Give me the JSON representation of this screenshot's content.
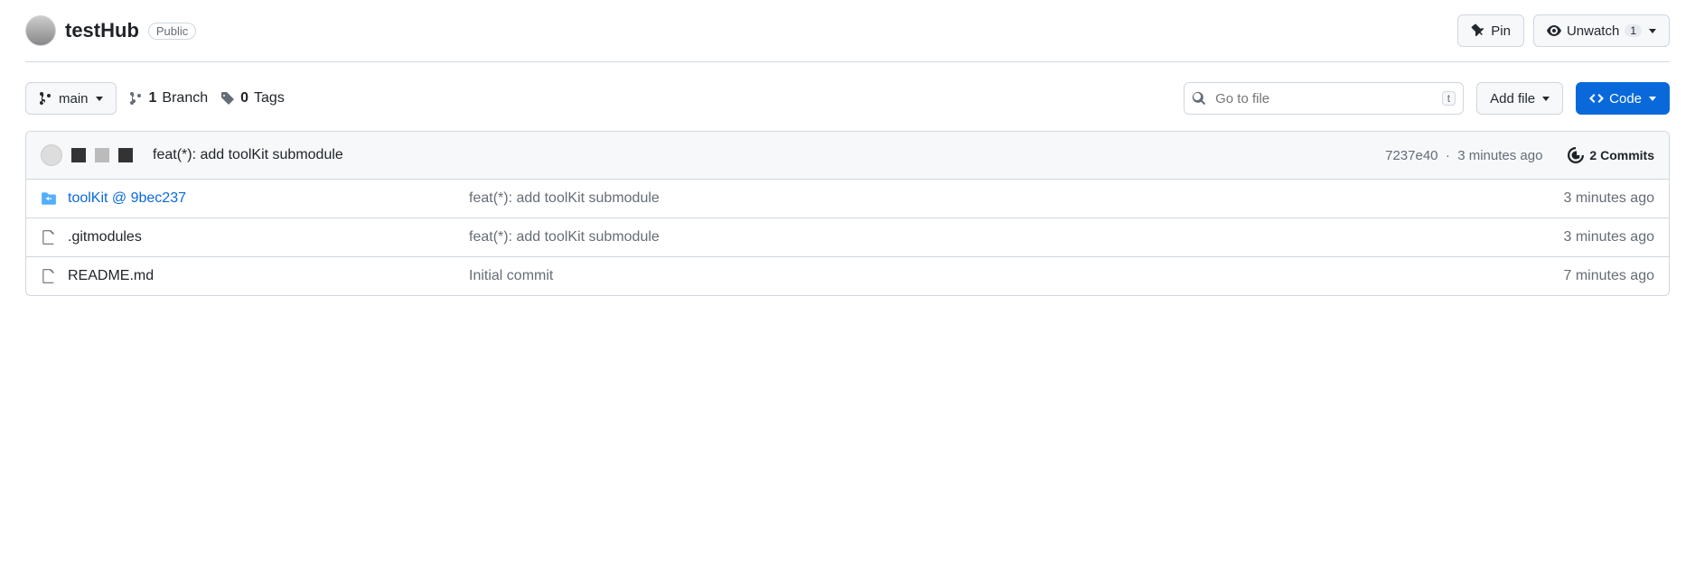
{
  "header": {
    "repo_name": "testHub",
    "visibility": "Public",
    "pin_label": "Pin",
    "unwatch_label": "Unwatch",
    "watch_count": "1"
  },
  "toolbar": {
    "branch_name": "main",
    "branches_count": "1",
    "branches_label": "Branch",
    "tags_count": "0",
    "tags_label": "Tags",
    "search_placeholder": "Go to file",
    "search_kbd": "t",
    "add_file_label": "Add file",
    "code_label": "Code"
  },
  "latest_commit": {
    "message": "feat(*): add toolKit submodule",
    "sha": "7237e40",
    "time": "3 minutes ago",
    "commits_count": "2 Commits"
  },
  "files": [
    {
      "type": "submodule",
      "name": "toolKit @ 9bec237",
      "message": "feat(*): add toolKit submodule",
      "time": "3 minutes ago"
    },
    {
      "type": "file",
      "name": ".gitmodules",
      "message": "feat(*): add toolKit submodule",
      "time": "3 minutes ago"
    },
    {
      "type": "file",
      "name": "README.md",
      "message": "Initial commit",
      "time": "7 minutes ago"
    }
  ]
}
